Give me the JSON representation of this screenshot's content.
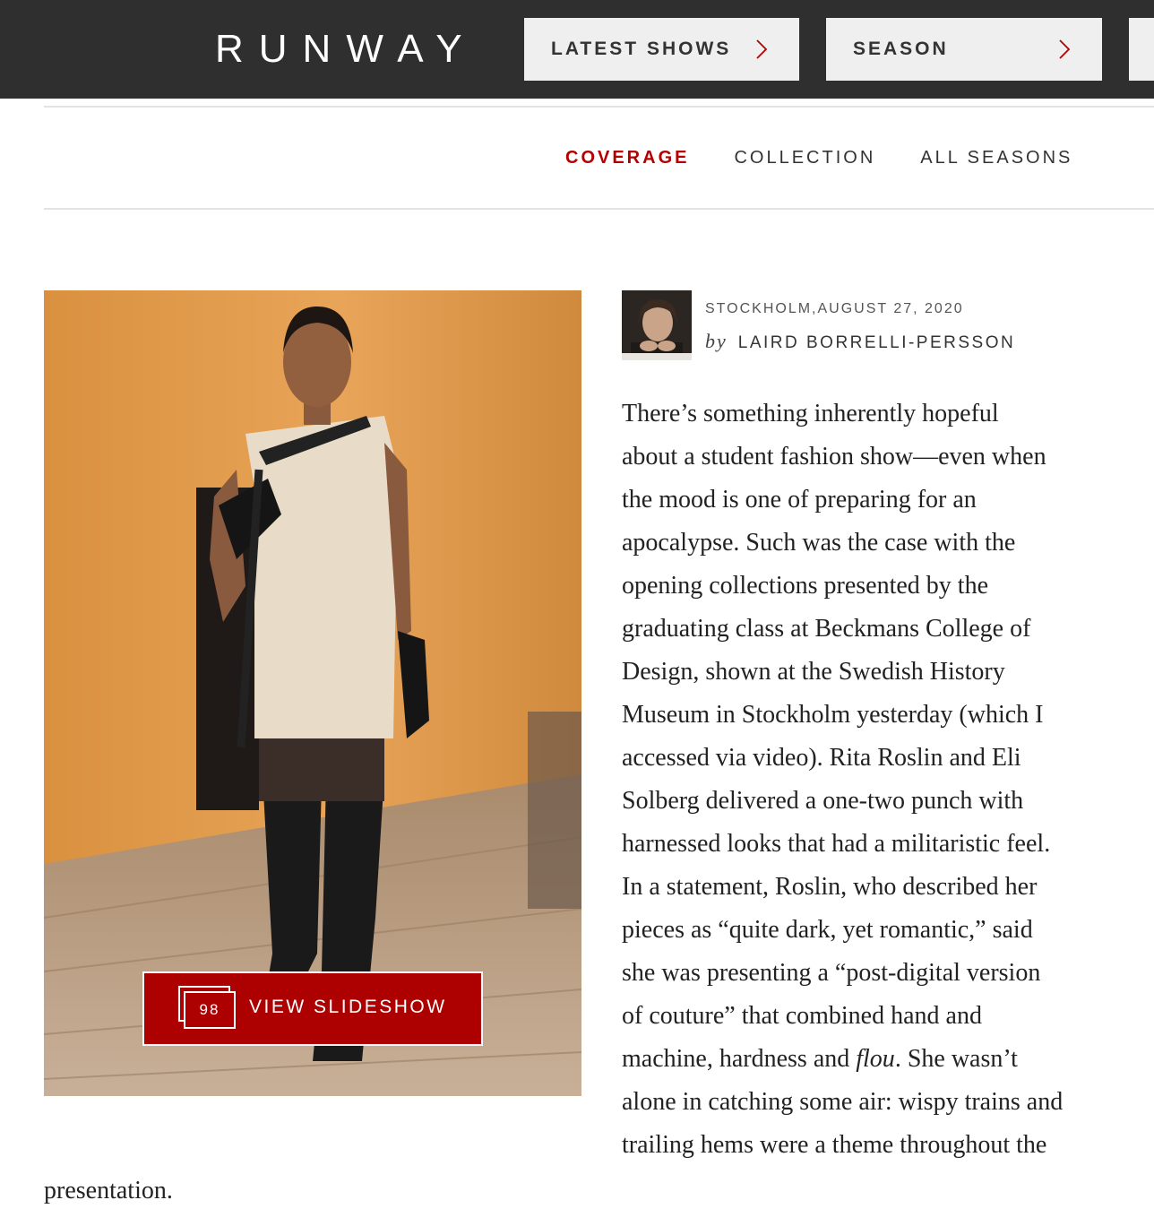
{
  "header": {
    "logo": "RUNWAY",
    "buttons": [
      {
        "label": "LATEST SHOWS"
      },
      {
        "label": "SEASON"
      }
    ]
  },
  "subnav": {
    "items": [
      {
        "label": "COVERAGE",
        "active": true
      },
      {
        "label": "COLLECTION",
        "active": false
      },
      {
        "label": "ALL SEASONS",
        "active": false
      }
    ]
  },
  "slideshow": {
    "count": "98",
    "label": "VIEW SLIDESHOW"
  },
  "byline": {
    "dateline": "STOCKHOLM,AUGUST 27, 2020",
    "by": "by",
    "author": "LAIRD BORRELLI-PERSSON"
  },
  "article": {
    "lines": [
      "There’s something inherently hopeful",
      "about a student fashion show—even when",
      "the mood is one of preparing for an",
      "apocalypse. Such was the case with the",
      "opening collections presented by the",
      "graduating class at Beckmans College of",
      "Design, shown at the Swedish History",
      "Museum in Stockholm yesterday (which I",
      "accessed via video). Rita Roslin and Eli",
      "Solberg delivered a one-two punch with",
      "harnessed looks that had a militaristic feel.",
      "In a statement, Roslin, who described her",
      "pieces as “quite dark, yet romantic,” said",
      "she was presenting a “post-digital version",
      "of couture” that combined hand and"
    ],
    "line16_before": "machine, hardness and ",
    "line16_italic": "flou",
    "line16_after": ". She wasn’t",
    "line17": "alone in catching some air: wispy trains and",
    "line18": "trailing hems were a theme throughout the",
    "tail": "presentation."
  },
  "colors": {
    "header_bg": "#2f2f2f",
    "accent_red": "#ad0000",
    "active_nav": "#b30000"
  },
  "icons": {
    "dropdown": "chevron-right-icon",
    "slideshow": "stacked-slides-icon"
  }
}
